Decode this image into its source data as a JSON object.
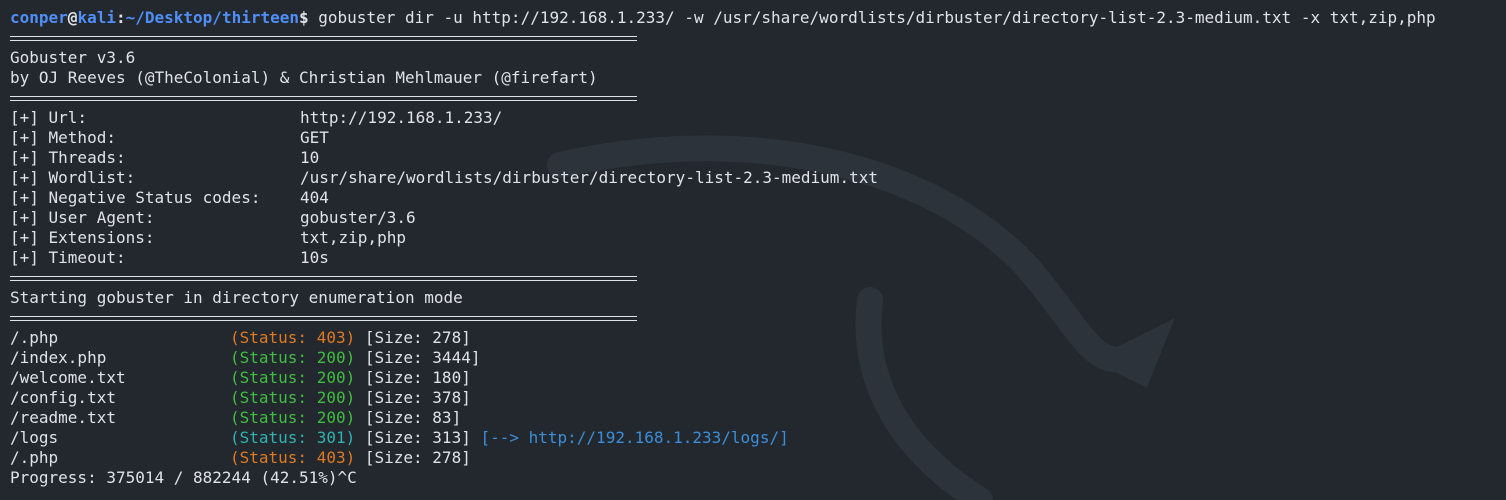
{
  "prompt": {
    "user": "conper",
    "at": "@",
    "host": "kali",
    "colon": ":",
    "cwd": "~/Desktop/thirteen",
    "symbol": "$",
    "command": " gobuster dir -u http://192.168.1.233/ -w /usr/share/wordlists/dirbuster/directory-list-2.3-medium.txt -x txt,zip,php"
  },
  "banner": {
    "version": "Gobuster v3.6",
    "authors": "by OJ Reeves (@TheColonial) & Christian Mehlmauer (@firefart)"
  },
  "options": [
    {
      "label": "[+] Url:",
      "value": "http://192.168.1.233/"
    },
    {
      "label": "[+] Method:",
      "value": "GET"
    },
    {
      "label": "[+] Threads:",
      "value": "10"
    },
    {
      "label": "[+] Wordlist:",
      "value": "/usr/share/wordlists/dirbuster/directory-list-2.3-medium.txt"
    },
    {
      "label": "[+] Negative Status codes:",
      "value": "404"
    },
    {
      "label": "[+] User Agent:",
      "value": "gobuster/3.6"
    },
    {
      "label": "[+] Extensions:",
      "value": "txt,zip,php"
    },
    {
      "label": "[+] Timeout:",
      "value": "10s"
    }
  ],
  "mode_line": "Starting gobuster in directory enumeration mode",
  "results": [
    {
      "path": "/.php",
      "status": "(Status: 403)",
      "size": " [Size: 278]",
      "redirect": ""
    },
    {
      "path": "/index.php",
      "status": "(Status: 200)",
      "size": " [Size: 3444]",
      "redirect": ""
    },
    {
      "path": "/welcome.txt",
      "status": "(Status: 200)",
      "size": " [Size: 180]",
      "redirect": ""
    },
    {
      "path": "/config.txt",
      "status": "(Status: 200)",
      "size": " [Size: 378]",
      "redirect": ""
    },
    {
      "path": "/readme.txt",
      "status": "(Status: 200)",
      "size": " [Size: 83]",
      "redirect": ""
    },
    {
      "path": "/logs",
      "status": "(Status: 301)",
      "size": " [Size: 313]",
      "redirect": " [--> http://192.168.1.233/logs/]"
    },
    {
      "path": "/.php",
      "status": "(Status: 403)",
      "size": " [Size: 278]",
      "redirect": ""
    }
  ],
  "progress": "Progress: 375014 / 882244 (42.51%)^C",
  "colors": {
    "background": "#23272e",
    "text": "#dfe3e8",
    "prompt": "#4f8ff7",
    "status_403": "#e07a1f",
    "status_200": "#3fbf3f",
    "status_301": "#2fb3b3",
    "redirect": "#3a8fd8"
  }
}
